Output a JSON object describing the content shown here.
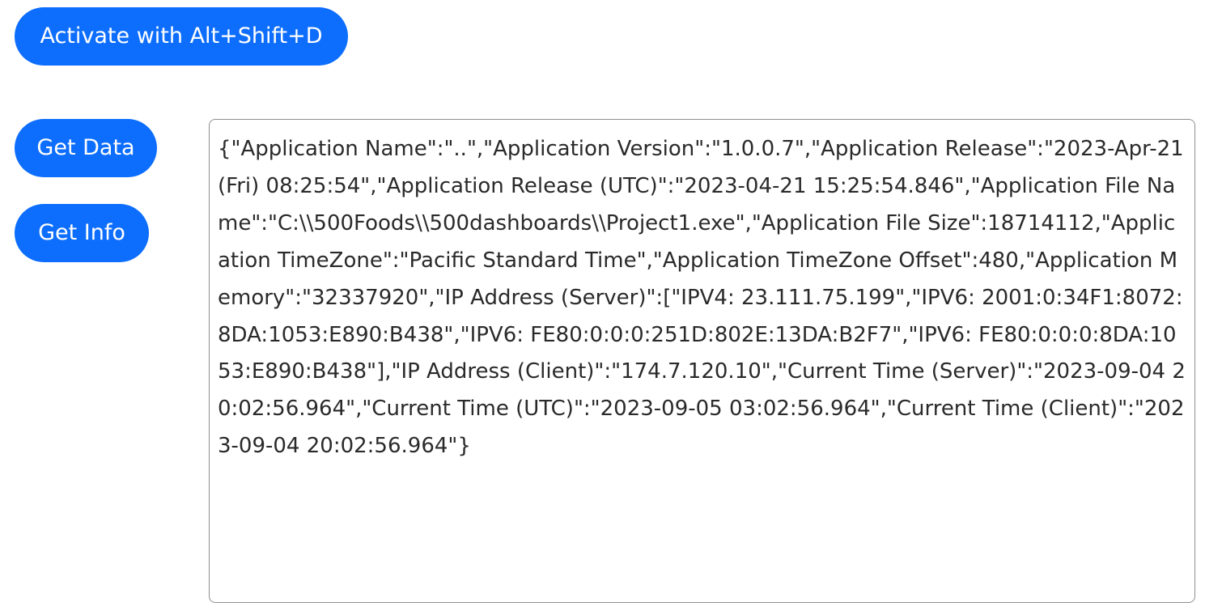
{
  "buttons": {
    "activate_label": "Activate with Alt+Shift+D",
    "get_data_label": "Get Data",
    "get_info_label": "Get Info"
  },
  "output": {
    "value": "{\"Application Name\":\"..\",\"Application Version\":\"1.0.0.7\",\"Application Release\":\"2023-Apr-21 (Fri) 08:25:54\",\"Application Release (UTC)\":\"2023-04-21 15:25:54.846\",\"Application File Name\":\"C:\\\\500Foods\\\\500dashboards\\\\Project1.exe\",\"Application File Size\":18714112,\"Application TimeZone\":\"Pacific Standard Time\",\"Application TimeZone Offset\":480,\"Application Memory\":\"32337920\",\"IP Address (Server)\":[\"IPV4: 23.111.75.199\",\"IPV6: 2001:0:34F1:8072:8DA:1053:E890:B438\",\"IPV6: FE80:0:0:0:251D:802E:13DA:B2F7\",\"IPV6: FE80:0:0:0:8DA:1053:E890:B438\"],\"IP Address (Client)\":\"174.7.120.10\",\"Current Time (Server)\":\"2023-09-04 20:02:56.964\",\"Current Time (UTC)\":\"2023-09-05 03:02:56.964\",\"Current Time (Client)\":\"2023-09-04 20:02:56.964\"}"
  },
  "colors": {
    "button_bg": "#0d6efd",
    "button_text": "#ffffff",
    "textarea_border": "#8f8f8f"
  }
}
